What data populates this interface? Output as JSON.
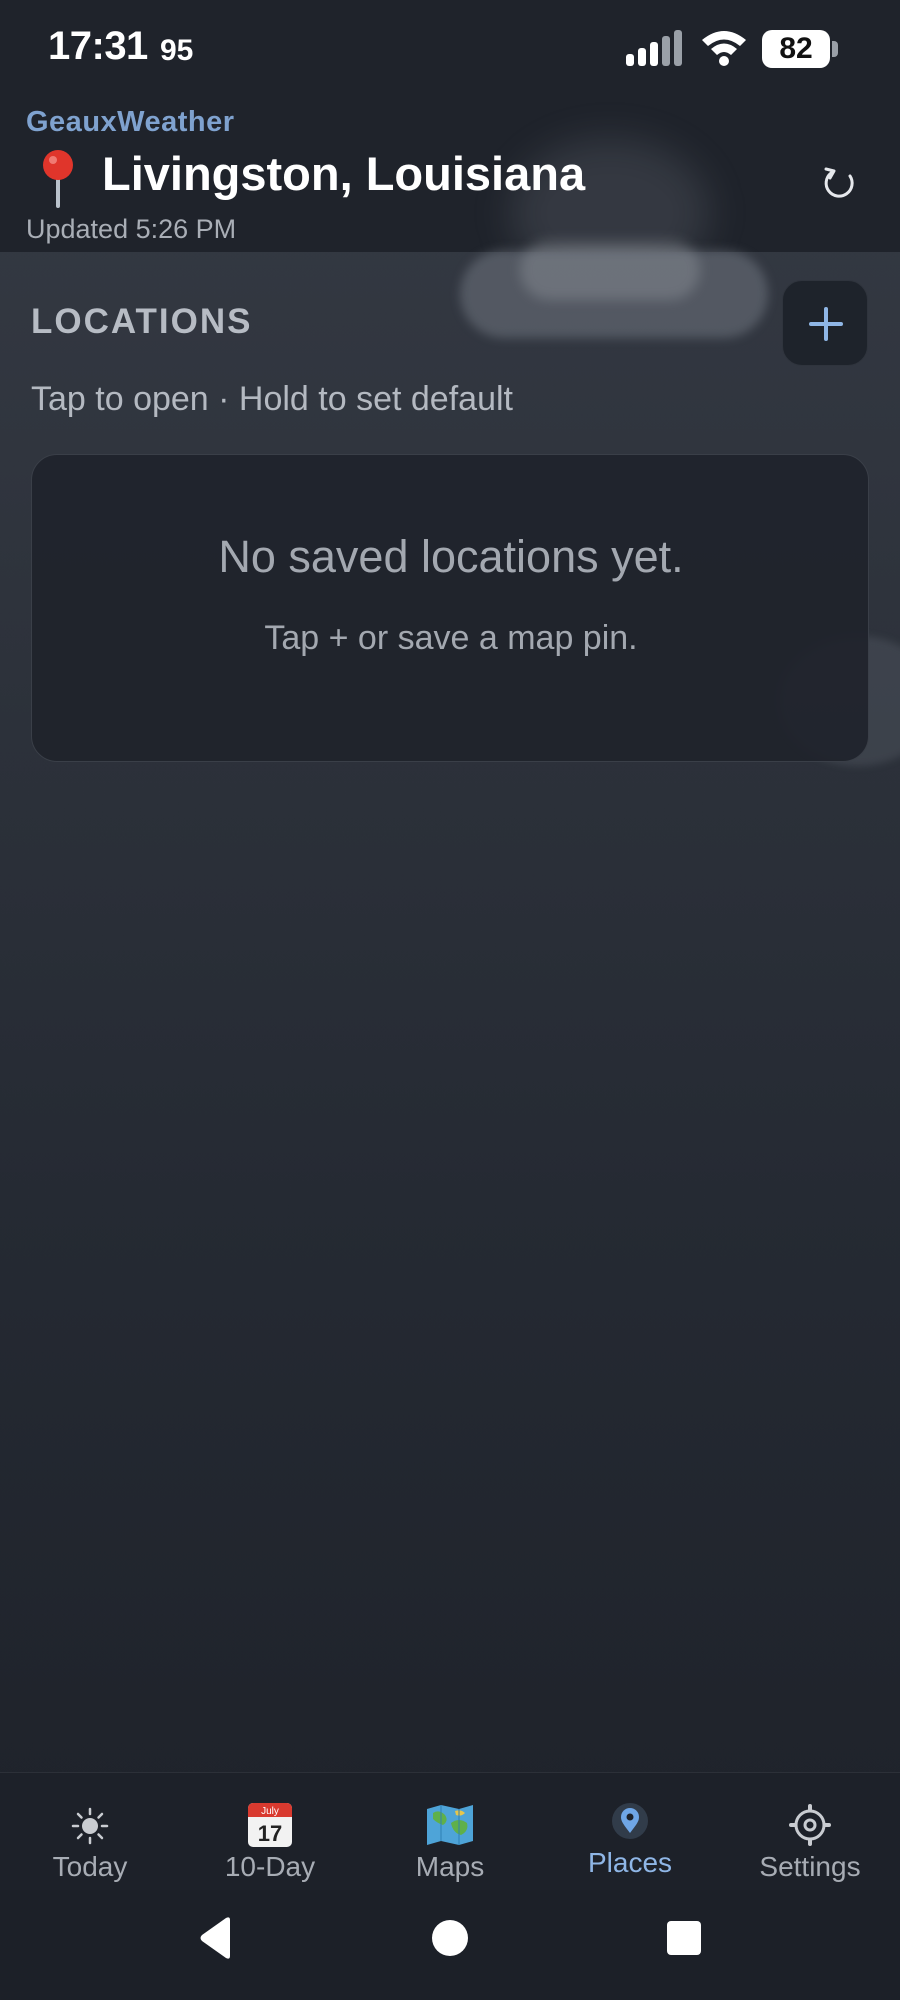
{
  "status_bar": {
    "time": "17:31",
    "extra": "95",
    "battery": "82",
    "icons": [
      "signal-icon",
      "wifi-icon",
      "battery-icon"
    ]
  },
  "header": {
    "app_name": "GeauxWeather",
    "location": "Livingston, Louisiana",
    "updated": "Updated 5:26 PM",
    "icons": [
      "map-pin-icon",
      "refresh-icon"
    ]
  },
  "locations": {
    "title": "LOCATIONS",
    "hint": "Tap to open · Hold to set default",
    "add_icon": "plus-icon",
    "empty_title": "No saved locations yet.",
    "empty_subtitle": "Tap + or save a map pin."
  },
  "nav": {
    "items": [
      {
        "label": "Today",
        "icon": "sun-icon"
      },
      {
        "label": "10-Day",
        "icon": "calendar-icon",
        "icon_month": "July",
        "icon_day": "17"
      },
      {
        "label": "Maps",
        "icon": "map-icon"
      },
      {
        "label": "Places",
        "icon": "location-pin-icon",
        "active": true
      },
      {
        "label": "Settings",
        "icon": "gear-icon"
      }
    ]
  },
  "system_nav": {
    "icons": [
      "back-icon",
      "home-icon",
      "recents-icon"
    ]
  },
  "colors": {
    "accent": "#8fb6e6",
    "brand": "#7fa2cf",
    "background": "#2a2f38",
    "pin_red": "#e0352b"
  }
}
